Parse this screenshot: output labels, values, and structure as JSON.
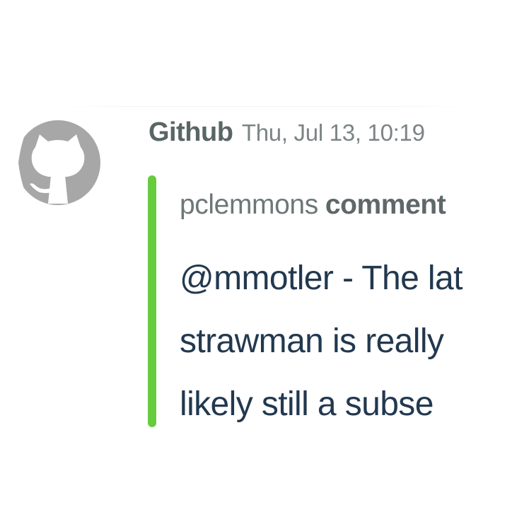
{
  "colors": {
    "accent_bar": "#67cb3e",
    "avatar_bg": "#a7a7a7",
    "text_primary": "#22384f"
  },
  "message": {
    "sender": "Github",
    "timestamp": "Thu, Jul 13, 10:19",
    "avatar_icon": "github-octocat-icon"
  },
  "attachment": {
    "author": "pclemmons",
    "action": "comment",
    "lines": [
      "@mmotler - The lat",
      "strawman is really",
      "likely still a subse"
    ]
  }
}
